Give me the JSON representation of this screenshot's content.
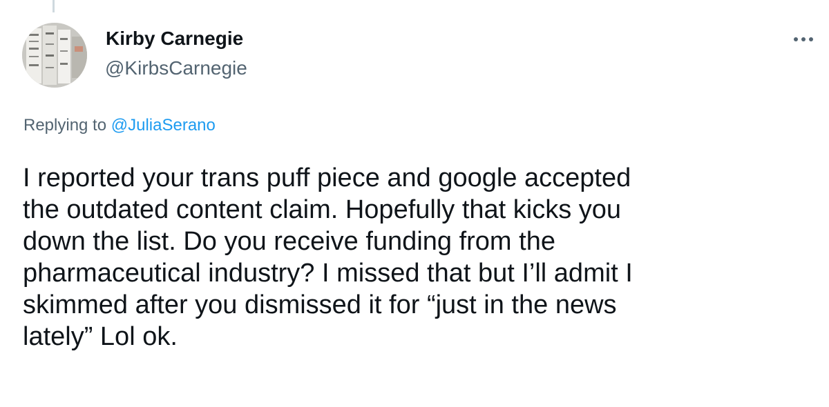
{
  "tweet": {
    "author": {
      "name": "Kirby Carnegie",
      "handle": "@KirbsCarnegie"
    },
    "reply": {
      "prefix": "Replying to",
      "mention": "@JuliaSerano"
    },
    "text_lines": [
      "I reported your trans puff piece and google accepted",
      "the outdated content claim. Hopefully that kicks you",
      "down the list. Do you receive funding from the",
      "pharmaceutical industry? I missed that but I’ll admit I",
      "skimmed after you dismissed it for “just in the news",
      "lately” Lol ok."
    ],
    "icons": {
      "more": "more-options-icon"
    }
  },
  "colors": {
    "text": "#0f1419",
    "secondary": "#536471",
    "link": "#1d9bf0",
    "thread_line": "#cfd9de"
  }
}
